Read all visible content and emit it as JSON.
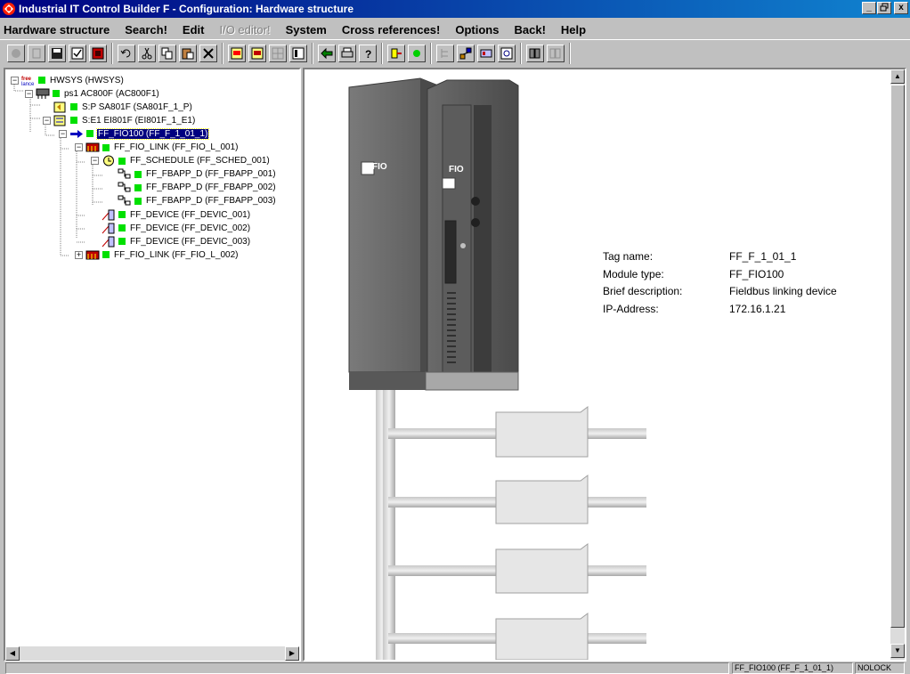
{
  "window": {
    "title": "Industrial IT Control Builder F - Configuration: Hardware structure",
    "buttons": [
      "_",
      "▫",
      "x"
    ]
  },
  "menu": [
    {
      "label": "Hardware structure",
      "enabled": true
    },
    {
      "label": "Search!",
      "enabled": true
    },
    {
      "label": "Edit",
      "enabled": true
    },
    {
      "label": "I/O editor!",
      "enabled": false
    },
    {
      "label": "System",
      "enabled": true
    },
    {
      "label": "Cross references!",
      "enabled": true
    },
    {
      "label": "Options",
      "enabled": true
    },
    {
      "label": "Back!",
      "enabled": true
    },
    {
      "label": "Help",
      "enabled": true
    }
  ],
  "tree": {
    "nodes": [
      {
        "label": "HWSYS (HWSYS)",
        "icon": "freelance-icon",
        "level": 0,
        "expander": "minus"
      },
      {
        "label": "ps1  AC800F (AC800F1)",
        "icon": "controller-icon",
        "level": 1,
        "expander": "minus"
      },
      {
        "label": "S:P  SA801F (SA801F_1_P)",
        "icon": "power-supply-icon",
        "level": 2,
        "expander": "none"
      },
      {
        "label": "S:E1  EI801F (EI801F_1_E1)",
        "icon": "ethernet-module-icon",
        "level": 2,
        "expander": "minus"
      },
      {
        "label": "FF_FIO100 (FF_F_1_01_1)",
        "icon": "arrow-right-icon",
        "level": 3,
        "expander": "minus",
        "selected": true
      },
      {
        "label": "FF_FIO_LINK (FF_FIO_L_001)",
        "icon": "fieldbus-link-icon",
        "level": 4,
        "expander": "minus"
      },
      {
        "label": "FF_SCHEDULE (FF_SCHED_001)",
        "icon": "schedule-icon",
        "level": 5,
        "expander": "minus"
      },
      {
        "label": "FF_FBAPP_D (FF_FBAPP_001)",
        "icon": "function-block-app-icon",
        "level": 6,
        "expander": "none"
      },
      {
        "label": "FF_FBAPP_D (FF_FBAPP_002)",
        "icon": "function-block-app-icon",
        "level": 6,
        "expander": "none"
      },
      {
        "label": "FF_FBAPP_D (FF_FBAPP_003)",
        "icon": "function-block-app-icon",
        "level": 6,
        "expander": "none"
      },
      {
        "label": "FF_DEVICE (FF_DEVIC_001)",
        "icon": "field-device-icon",
        "level": 5,
        "expander": "none"
      },
      {
        "label": "FF_DEVICE (FF_DEVIC_002)",
        "icon": "field-device-icon",
        "level": 5,
        "expander": "none"
      },
      {
        "label": "FF_DEVICE (FF_DEVIC_003)",
        "icon": "field-device-icon",
        "level": 5,
        "expander": "none"
      },
      {
        "label": "FF_FIO_LINK (FF_FIO_L_002)",
        "icon": "fieldbus-link-icon",
        "level": 4,
        "expander": "plus"
      }
    ]
  },
  "module": {
    "front_label_left": "FIO",
    "front_label_right": "FIO",
    "info": [
      {
        "key": "Tag name:",
        "value": "FF_F_1_01_1"
      },
      {
        "key": "Module type:",
        "value": "FF_FIO100"
      },
      {
        "key": "Brief description:",
        "value": "Fieldbus linking device"
      },
      {
        "key": "IP-Address:",
        "value": "172.16.1.21"
      }
    ]
  },
  "status": {
    "object": "FF_FIO100 (FF_F_1_01_1)",
    "lock": "NOLOCK"
  },
  "colors": {
    "title_start": "#000080",
    "title_end": "#1084d0",
    "status_ok": "#00e000",
    "selection": "#000080"
  }
}
